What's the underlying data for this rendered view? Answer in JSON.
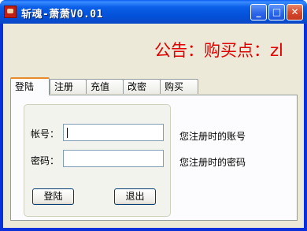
{
  "window": {
    "title": "斩魂-萧萧V0.01"
  },
  "notice": "公告：购买点：zl",
  "tabs": [
    "登陆",
    "注册",
    "充值",
    "改密",
    "购买"
  ],
  "form": {
    "account_label": "帐号：",
    "account_value": "",
    "password_label": "密码：",
    "password_value": "",
    "login_button": "登陆",
    "exit_button": "退出"
  },
  "hints": {
    "account": "您注册时的账号",
    "password": "您注册时的密码"
  },
  "colors": {
    "notice": "#e00000",
    "titlebar": "#0a5fe8",
    "face": "#ece9d8"
  }
}
